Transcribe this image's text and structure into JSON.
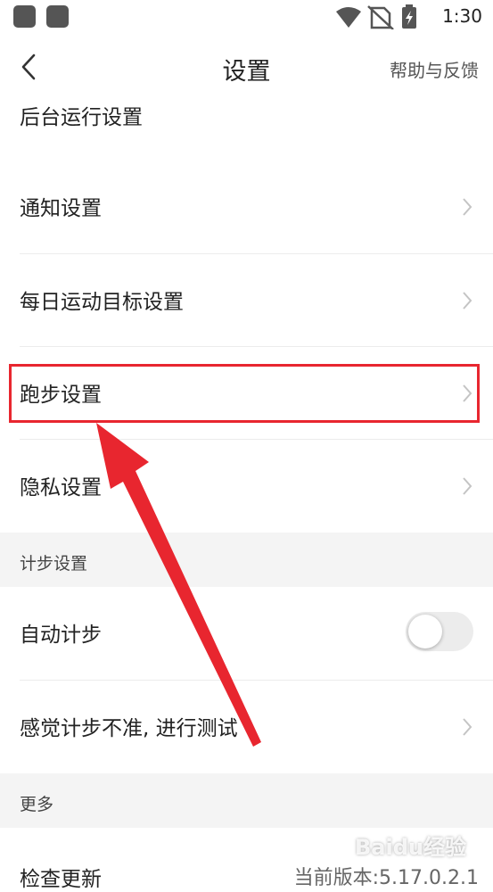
{
  "status_bar": {
    "time": "1:30"
  },
  "header": {
    "title": "设置",
    "help": "帮助与反馈"
  },
  "rows": {
    "background_run": "后台运行设置",
    "notification": "通知设置",
    "daily_goal": "每日运动目标设置",
    "running": "跑步设置",
    "privacy": "隐私设置",
    "auto_step": "自动计步",
    "step_test": "感觉计步不准, 进行测试",
    "check_update": "检查更新"
  },
  "sections": {
    "step_settings": "计步设置",
    "more": "更多"
  },
  "version_text": "当前版本:5.17.0.2.1",
  "toggles": {
    "auto_step_on": false
  },
  "watermark": "Baidu经验",
  "colors": {
    "highlight": "#e8262f",
    "section_bg": "#f4f4f4",
    "toggle_off": "#ececec"
  }
}
